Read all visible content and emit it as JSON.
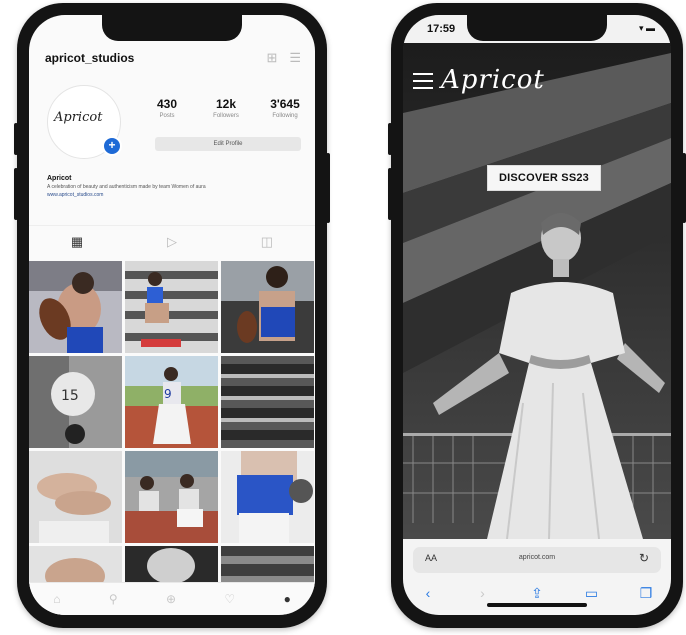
{
  "instagram": {
    "username": "apricot_studios",
    "header_icons": [
      "plus-square-icon",
      "menu-icon"
    ],
    "avatar_logo": "Apricot",
    "stats": [
      {
        "value": "430",
        "label": "Posts"
      },
      {
        "value": "12k",
        "label": "Followers"
      },
      {
        "value": "3'645",
        "label": "Following"
      }
    ],
    "edit_button": "Edit Profile",
    "bio_name": "Apricot",
    "bio_text": "A celebration of beauty and authenticism made by team Women of aura",
    "bio_link": "www.apricot_studios.com",
    "tabs": [
      "grid-icon",
      "reels-icon",
      "tagged-icon"
    ],
    "bottom_nav": [
      "home-icon",
      "search-icon",
      "add-icon",
      "heart-icon",
      "profile-icon"
    ]
  },
  "website": {
    "time": "17:59",
    "status_icons": "▾ ▬",
    "brand": "Apricot",
    "banner": "DISCOVER SS23",
    "url_aa": "AA",
    "url": "apricot.com",
    "nav_icons": [
      "back-icon",
      "forward-icon",
      "share-icon",
      "bookmarks-icon",
      "tabs-icon"
    ]
  },
  "colors": {
    "phone_frame": "#141414",
    "accent_blue": "#1e6ad6",
    "safari_blue": "#2a7ae2"
  }
}
